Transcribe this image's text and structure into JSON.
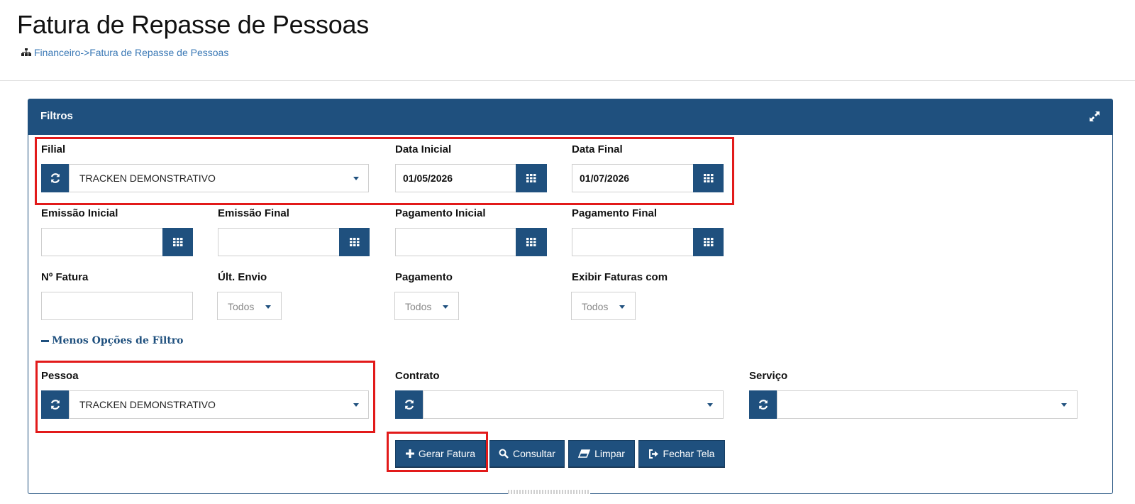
{
  "page": {
    "title": "Fatura de Repasse de Pessoas",
    "breadcrumb": "Financeiro->Fatura de Repasse de Pessoas"
  },
  "panel": {
    "title": "Filtros"
  },
  "filters": {
    "filial": {
      "label": "Filial",
      "value": "TRACKEN DEMONSTRATIVO"
    },
    "data_inicial": {
      "label": "Data Inicial",
      "value": "01/05/2026"
    },
    "data_final": {
      "label": "Data Final",
      "value": "01/07/2026"
    },
    "emissao_inicial": {
      "label": "Emissão Inicial",
      "value": ""
    },
    "emissao_final": {
      "label": "Emissão Final",
      "value": ""
    },
    "pagamento_inicial": {
      "label": "Pagamento Inicial",
      "value": ""
    },
    "pagamento_final": {
      "label": "Pagamento Final",
      "value": ""
    },
    "numero_fatura": {
      "label": "Nº Fatura",
      "value": ""
    },
    "ult_envio": {
      "label": "Últ. Envio",
      "value": "Todos"
    },
    "pagamento": {
      "label": "Pagamento",
      "value": "Todos"
    },
    "exibir_faturas": {
      "label": "Exibir Faturas com",
      "value": "Todos"
    },
    "toggle_label": "Menos Opções de Filtro",
    "pessoa": {
      "label": "Pessoa",
      "value": "TRACKEN DEMONSTRATIVO"
    },
    "contrato": {
      "label": "Contrato",
      "value": ""
    },
    "servico": {
      "label": "Serviço",
      "value": ""
    }
  },
  "actions": {
    "gerar_fatura": "Gerar Fatura",
    "consultar": "Consultar",
    "limpar": "Limpar",
    "fechar_tela": "Fechar Tela"
  },
  "colors": {
    "primary": "#1f507e",
    "highlight": "#e21a1a",
    "link": "#3a78b5"
  },
  "icons": {
    "breadcrumb": "sitemap-icon",
    "expand": "expand-icon",
    "refresh": "refresh-icon",
    "calendar": "calendar-grid-icon",
    "plus": "plus-icon",
    "search": "search-icon",
    "eraser": "eraser-icon",
    "exit": "sign-out-icon"
  }
}
